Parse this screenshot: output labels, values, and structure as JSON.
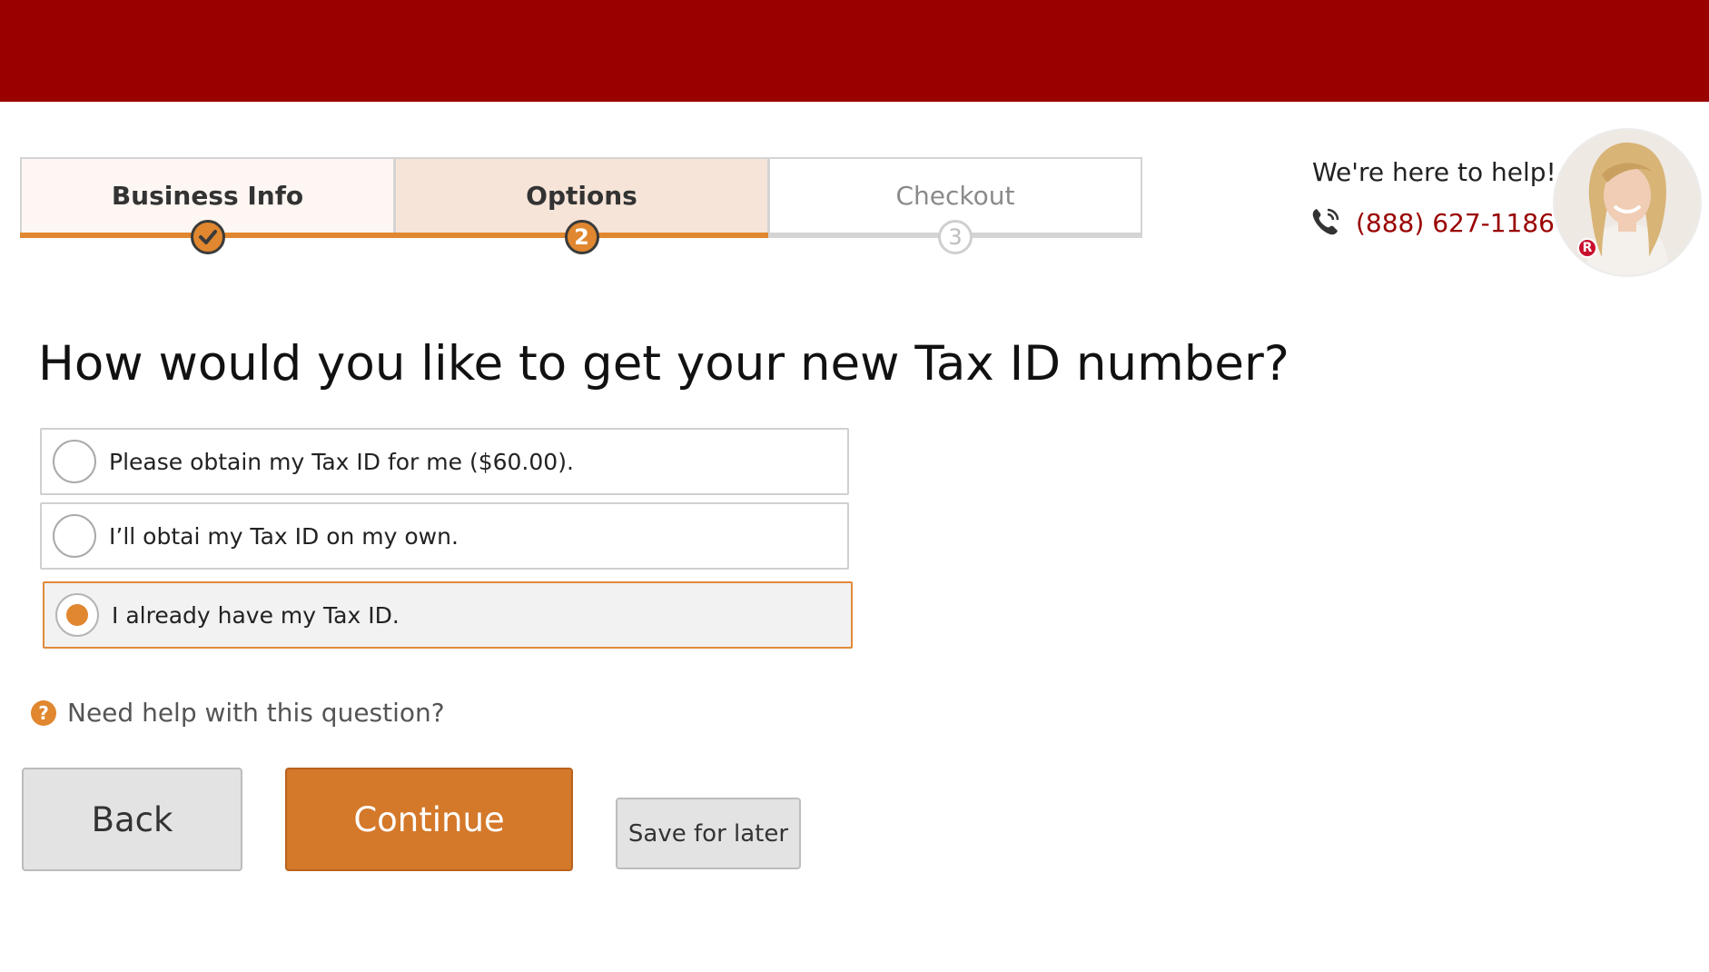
{
  "header": {
    "bar_color": "#990000"
  },
  "stepper": {
    "steps": [
      {
        "label": "Business Info",
        "state": "done",
        "bubble": ""
      },
      {
        "label": "Options",
        "state": "active",
        "bubble": "2"
      },
      {
        "label": "Checkout",
        "state": "todo",
        "bubble": "3"
      }
    ]
  },
  "help": {
    "text": "We're here to help!",
    "phone": "(888) 627-1186",
    "badge": "R"
  },
  "question": {
    "title": "How would you like to get your new Tax ID number?",
    "options": [
      {
        "label": "Please obtain my Tax ID for me ($60.00).",
        "selected": false
      },
      {
        "label": "I’ll obtai my Tax ID on my own.",
        "selected": false
      },
      {
        "label": "I already have my Tax ID.",
        "selected": true
      }
    ],
    "help_link": "Need help with this question?",
    "help_icon": "?"
  },
  "actions": {
    "back": "Back",
    "continue": "Continue",
    "save": "Save for later"
  },
  "colors": {
    "brand_red": "#990000",
    "accent_orange": "#e0872f",
    "continue_orange": "#d4782a"
  }
}
